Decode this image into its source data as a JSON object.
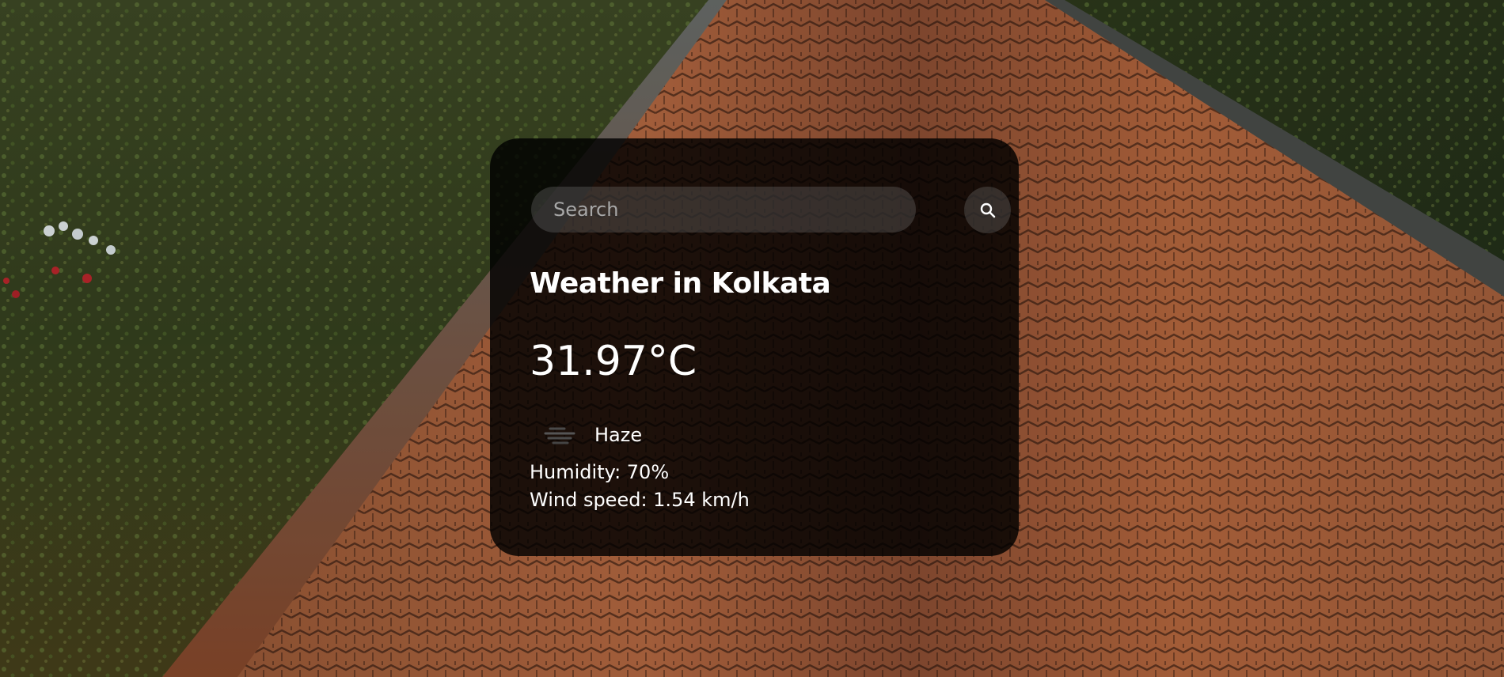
{
  "search": {
    "placeholder": "Search",
    "value": "",
    "button_icon": "search-icon"
  },
  "weather": {
    "title": "Weather in Kolkata",
    "temperature": "31.97°C",
    "condition_icon": "haze-icon",
    "condition": "Haze",
    "humidity": "Humidity: 70%",
    "wind": "Wind speed: 1.54 km/h"
  },
  "colors": {
    "card_background": "#000000",
    "text": "#ffffff",
    "control_background": "#7d7d7d"
  }
}
